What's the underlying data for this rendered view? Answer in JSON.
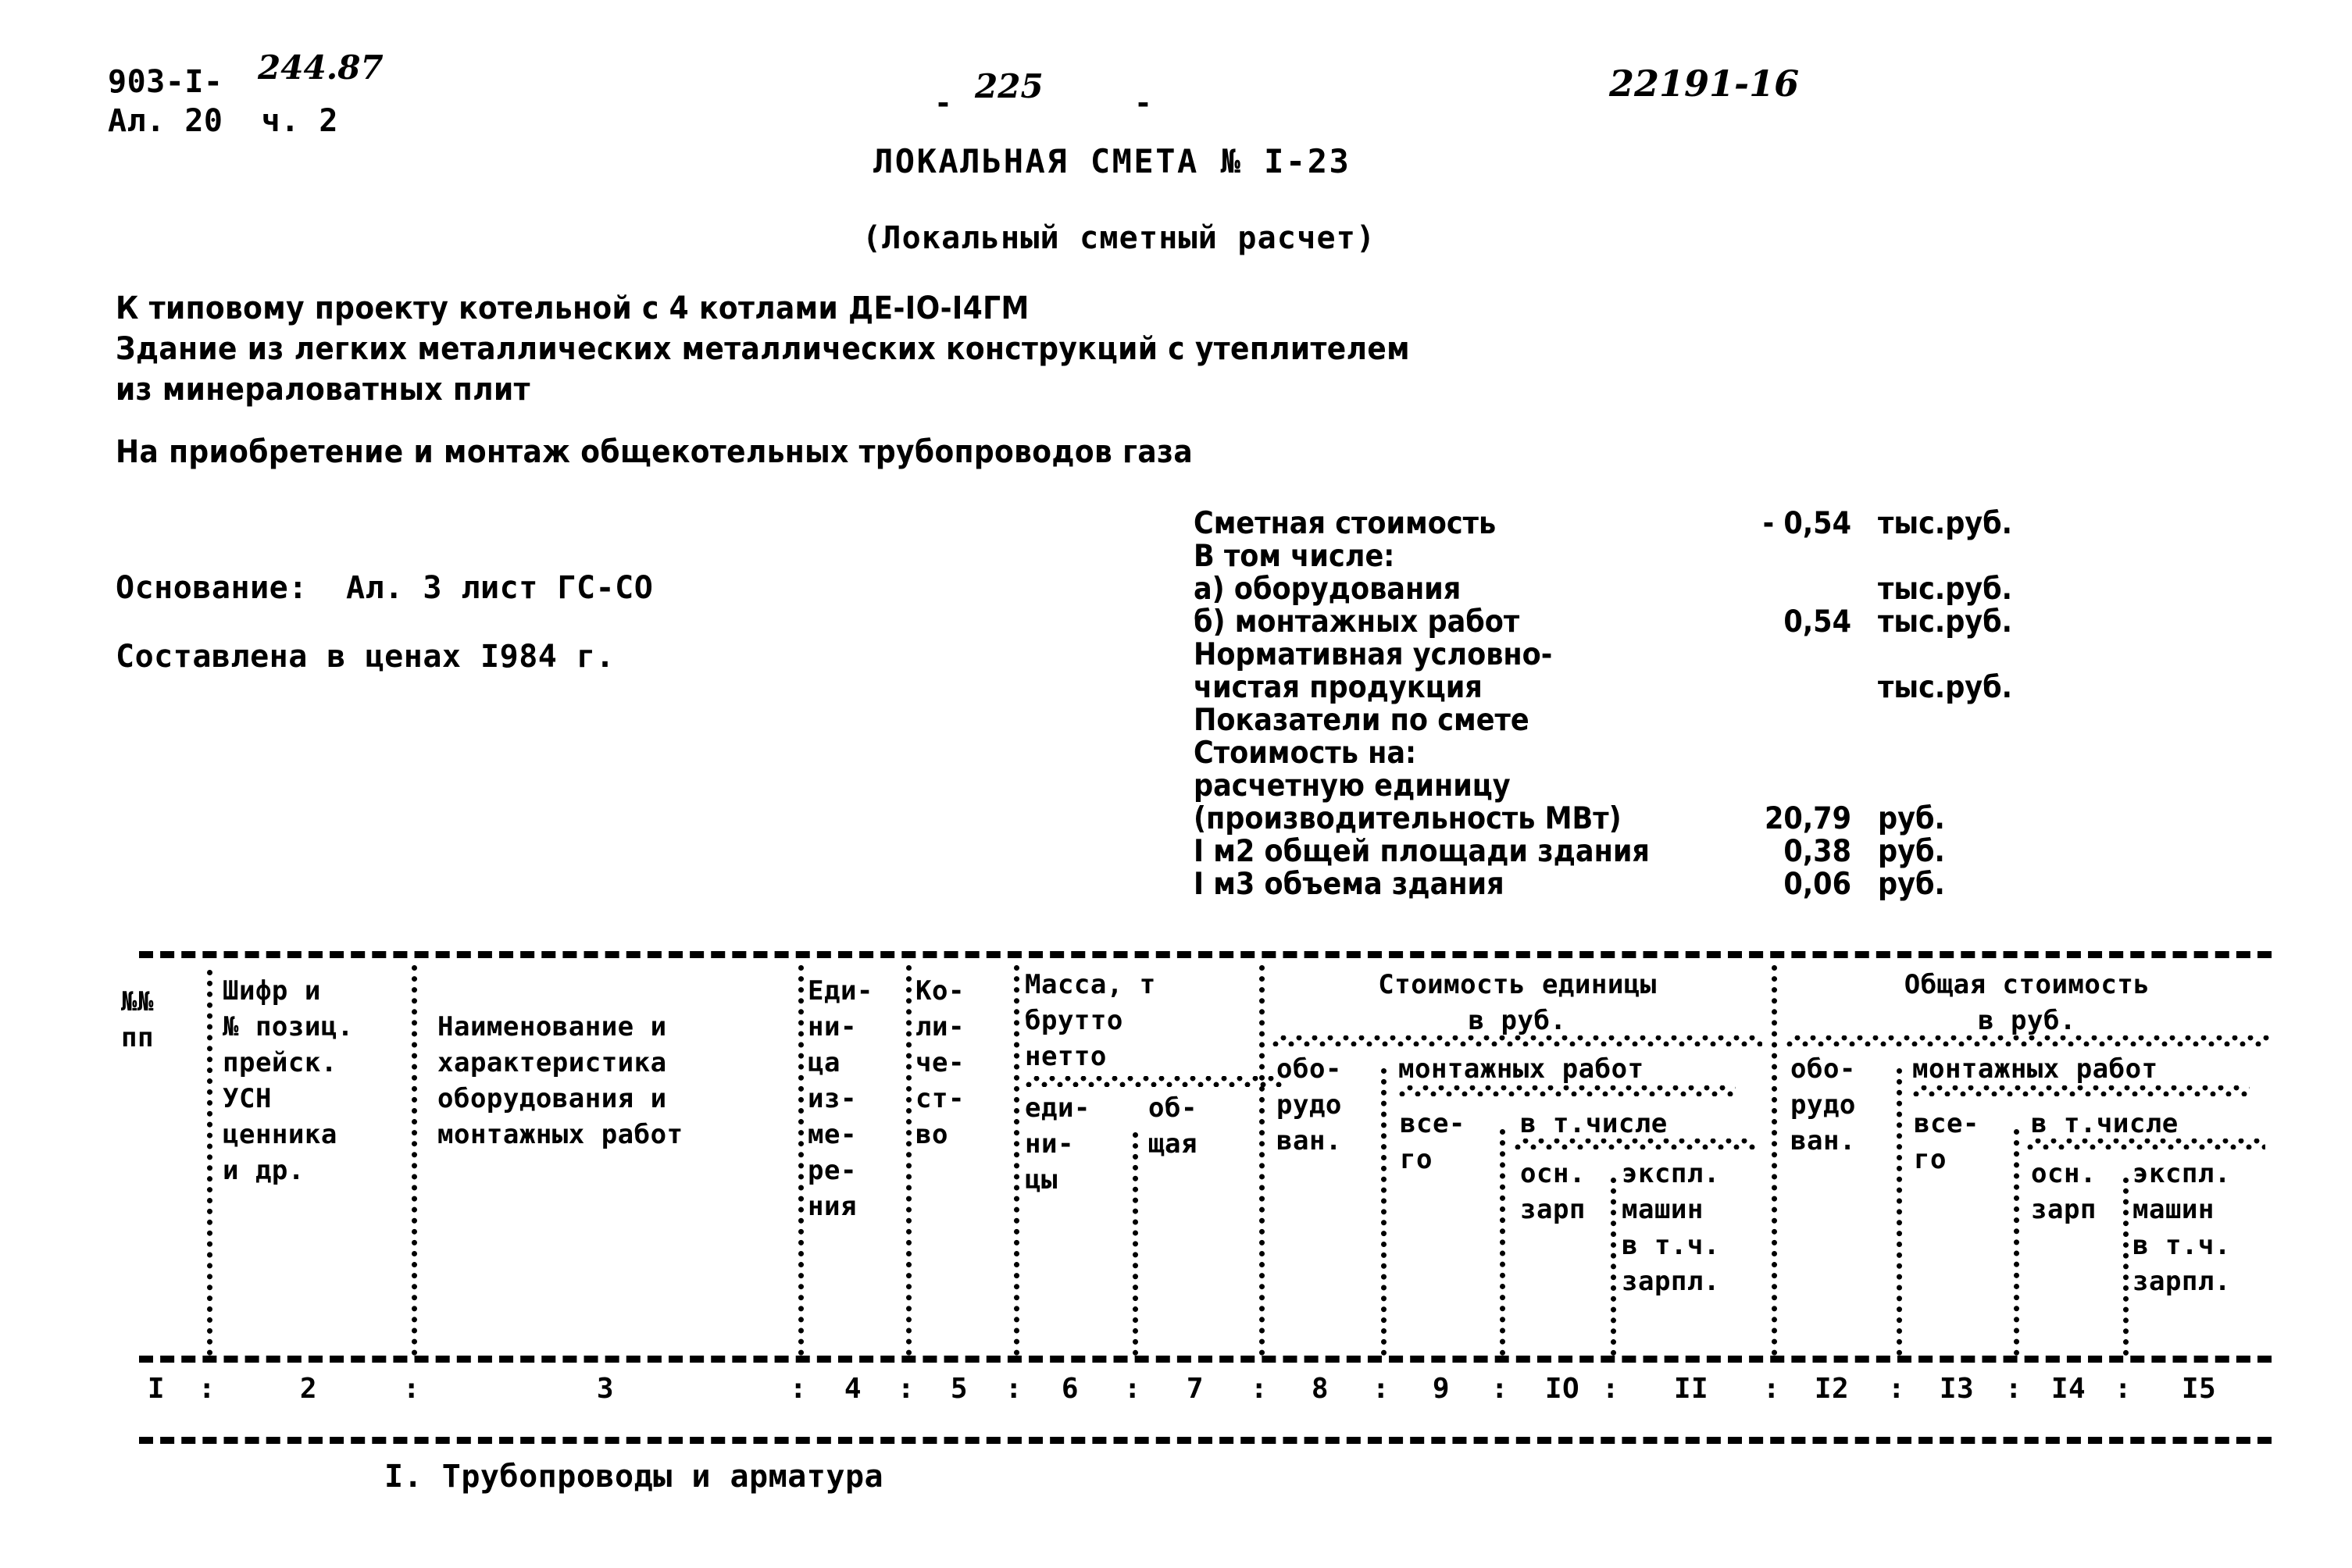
{
  "stamp": {
    "series_code": "903-I-",
    "series_hand": "244.87",
    "album_line": "Ал. 20  ч. 2"
  },
  "header": {
    "dash_left": "-",
    "page_number": "225",
    "dash_right": "-",
    "doc_code": "22191-16"
  },
  "title": {
    "main": "ЛОКАЛЬНАЯ СМЕТА № I-23",
    "sub": "(Локальный сметный расчет)"
  },
  "intro": {
    "line1": "К типовому проекту котельной с 4 котлами ДЕ-IО-I4ГМ",
    "line2": "Здание из легких металлических металлических конструкций с утеплителем",
    "line3": "из минераловатных плит",
    "subject": "На приобретение и монтаж общекотельных трубопроводов газа"
  },
  "left_info": {
    "basis": "Основание:  Ал. 3 лист ГС-СО",
    "price_year": "Составлена в ценах I984 г."
  },
  "summary": {
    "rows": [
      {
        "label": "Сметная стоимость",
        "value": "- 0,54",
        "unit": "тыс.руб."
      },
      {
        "label": "В том числе:",
        "value": "",
        "unit": ""
      },
      {
        "label": "а) оборудования",
        "value": "",
        "unit": "тыс.руб."
      },
      {
        "label": "б) монтажных работ",
        "value": "0,54",
        "unit": "тыс.руб."
      },
      {
        "label": "Нормативная условно-",
        "value": "",
        "unit": ""
      },
      {
        "label": "чистая продукция",
        "value": "",
        "unit": "тыс.руб."
      },
      {
        "label": "Показатели по смете",
        "value": "",
        "unit": ""
      },
      {
        "label": "Стоимость на:",
        "value": "",
        "unit": ""
      },
      {
        "label": "расчетную единицу",
        "value": "",
        "unit": ""
      },
      {
        "label": "(производительность МВт)",
        "value": "20,79",
        "unit": "руб."
      },
      {
        "label": "I м2 общей площади здания",
        "value": "0,38",
        "unit": "руб."
      },
      {
        "label": "I м3 объема здания",
        "value": "0,06",
        "unit": "руб."
      }
    ]
  },
  "table": {
    "headers": {
      "col1": "№№\nпп",
      "col2": "Шифр и\n№ позиц.\nпрейск.\nУСН\nценника\nи др.",
      "col3": "Наименование и\nхарактеристика\nоборудования и\nмонтажных работ",
      "col4": "Еди-\nни-\nца\nиз-\nме-\nре-\nния",
      "col5": "Ко-\nли-\nче-\nст-\nво",
      "mass_title": "Масса, т\nбрутто\nнетто",
      "col6": "еди-\nни-\nцы",
      "col7": "об-\nщая",
      "unit_cost_title": "Стоимость единицы\nв руб.",
      "col8": "обо-\nрудо\nван.",
      "col9_group": "монтажных работ",
      "col9": "все-\nго",
      "col10_group": "в т.числе",
      "col10": "осн.\nзарп",
      "col11": "экспл.\nмашин\nв т.ч.\nзарпл.",
      "total_cost_title": "Общая стоимость\nв руб.",
      "col12": "обо-\nрудо\nван.",
      "col13_group": "монтажных работ",
      "col13": "все-\nго",
      "col14_group": "в т.числе",
      "col14": "осн.\nзарп",
      "col15": "экспл.\nмашин\nв т.ч.\nзарпл."
    },
    "column_numbers": [
      "I",
      "2",
      "3",
      "4",
      "5",
      "6",
      "7",
      "8",
      "9",
      "IO",
      "II",
      "I2",
      "I3",
      "I4",
      "I5"
    ]
  },
  "body": {
    "section_heading": "I. Трубопроводы и арматура"
  }
}
